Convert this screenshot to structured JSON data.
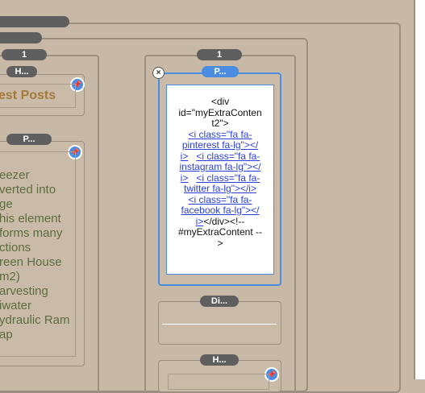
{
  "pills": {
    "top_bar": "",
    "second_bar": "",
    "col_left_count": "1",
    "col_mid_count": "1",
    "widget_h_left": "H...",
    "widget_p_left": "P...",
    "widget_p_selected": "P...",
    "widget_di": "Di...",
    "widget_h_mid": "H..."
  },
  "left": {
    "recent_posts": "est Posts",
    "lines": [
      "eezer",
      "verted into",
      "ge",
      "his element",
      "forms many",
      "ctions",
      "reen House",
      "m2)",
      "arvesting",
      "iwater",
      "ydraulic Ram",
      "ap"
    ]
  },
  "code": {
    "l1": "<div",
    "l2": "id=\"myExtraConten",
    "l3": "t2\">",
    "l4": "<i class=\"fa fa-",
    "l5": "pinterest fa-lg\"></",
    "l6a": "i>",
    "l6b": "<i class=\"fa fa-",
    "l7": "instagram fa-lg\"></",
    "l8a": "i>",
    "l8b": "<i class=\"fa fa-",
    "l9": "twitter fa-lg\"></i>",
    "l10": "<i class=\"fa fa-",
    "l11": "facebook fa-lg\"></",
    "l12a": "i>",
    "l12b": "</div><!--",
    "l13": "#myExtraContent --",
    "l14": ">"
  },
  "icons": {
    "pin": "pin-icon",
    "close": "close-icon"
  },
  "colors": {
    "background": "#c7b9a6",
    "accent": "#4a8ce0",
    "pill": "#5f5f5f"
  }
}
